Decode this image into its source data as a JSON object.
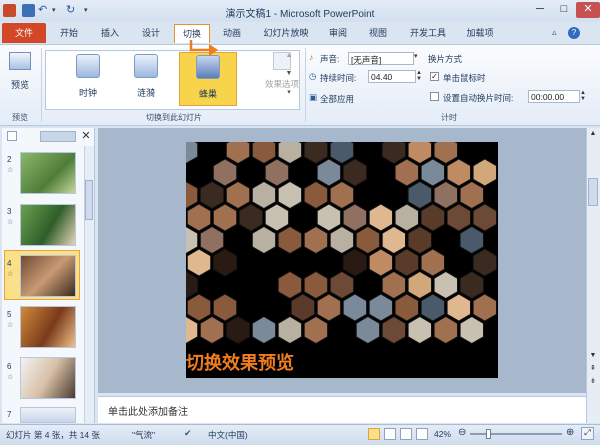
{
  "window": {
    "title": "演示文稿1 - Microsoft PowerPoint",
    "minimize": "─",
    "maximize": "□",
    "close": "✕"
  },
  "tabs": {
    "file": "文件",
    "items": [
      "开始",
      "插入",
      "设计",
      "切换",
      "动画",
      "幻灯片放映",
      "审阅",
      "视图",
      "开发工具",
      "加载项"
    ],
    "active": "切换"
  },
  "ribbon": {
    "preview_group": {
      "button": "预览",
      "label": "预览"
    },
    "transition_group": {
      "effects": [
        "时钟",
        "涟漪",
        "蜂巢"
      ],
      "selected_effect": "蜂巢",
      "effect_options": "效果选项",
      "label": "切换到此幻灯片"
    },
    "timing_group": {
      "sound_label": "声音:",
      "sound_value": "[无声音]",
      "duration_label": "持续时间:",
      "duration_value": "04.40",
      "apply_all": "全部应用",
      "advance_title": "换片方式",
      "on_click": "单击鼠标时",
      "on_click_checked": true,
      "auto_after": "设置自动换片时间:",
      "auto_after_checked": false,
      "auto_time": "00:00.00",
      "label": "计时"
    }
  },
  "slides_pane": {
    "slides": [
      {
        "number": "2",
        "star": "☆"
      },
      {
        "number": "3",
        "star": "☆"
      },
      {
        "number": "4",
        "star": "☆",
        "selected": true
      },
      {
        "number": "5",
        "star": "☆"
      },
      {
        "number": "6",
        "star": "☆"
      },
      {
        "number": "7",
        "star": "☆"
      }
    ]
  },
  "slide": {
    "caption": "切换效果预览"
  },
  "notes": {
    "placeholder": "单击此处添加备注"
  },
  "status": {
    "slide_info": "幻灯片 第 4 张，共 14 张",
    "theme": "\"气流\"",
    "language": "中文(中国)",
    "zoom": "42%"
  },
  "colors": {
    "file_tab": "#d24726",
    "accent": "#ee7d1f",
    "selected_effect": "#f7d44c"
  }
}
